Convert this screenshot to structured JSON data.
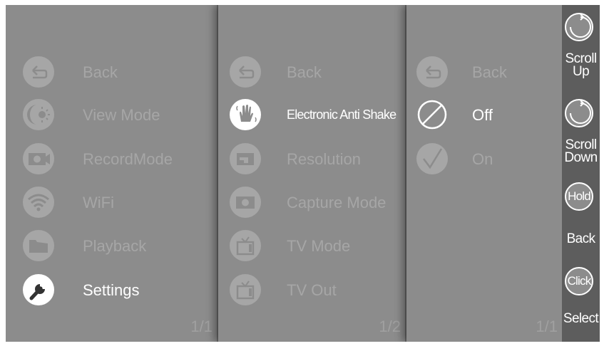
{
  "main_menu": {
    "items": [
      {
        "label": "Back",
        "icon": "back-arrow-icon"
      },
      {
        "label": "View Mode",
        "icon": "view-mode-icon"
      },
      {
        "label": "RecordMode",
        "icon": "record-camera-icon"
      },
      {
        "label": "WiFi",
        "icon": "wifi-icon"
      },
      {
        "label": "Playback",
        "icon": "folder-icon"
      },
      {
        "label": "Settings",
        "icon": "wrench-icon",
        "selected": true
      }
    ],
    "page": "1/1"
  },
  "settings_menu": {
    "items": [
      {
        "label": "Back",
        "icon": "back-arrow-icon"
      },
      {
        "label": "Electronic Anti Shake",
        "icon": "shaking-hand-icon",
        "selected": true
      },
      {
        "label": "Resolution",
        "icon": "resolution-icon"
      },
      {
        "label": "Capture Mode",
        "icon": "capture-camera-icon"
      },
      {
        "label": "TV Mode",
        "icon": "tv-icon"
      },
      {
        "label": "TV Out",
        "icon": "tv-icon"
      }
    ],
    "page": "1/2"
  },
  "option_menu": {
    "items": [
      {
        "label": "Back",
        "icon": "back-arrow-icon"
      },
      {
        "label": "Off",
        "icon": "off-circle-icon",
        "selected": true
      },
      {
        "label": "On",
        "icon": "checkmark-icon"
      }
    ],
    "page": "1/1"
  },
  "sidebar": {
    "scroll_up": {
      "label_line1": "Scroll",
      "label_line2": "Up",
      "icon": "rotate-clockwise-icon"
    },
    "scroll_down": {
      "label_line1": "Scroll",
      "label_line2": "Down",
      "icon": "rotate-clockwise-icon"
    },
    "hold": {
      "button_text": "Hold",
      "label": "Back"
    },
    "click": {
      "button_text": "Click",
      "label": "Select"
    }
  },
  "colors": {
    "background": "#6d6d6d",
    "panel": "#8c8c8c",
    "inactive": "#a6a6a6",
    "active": "#ffffff",
    "sidebar": "#5d5d5d"
  }
}
